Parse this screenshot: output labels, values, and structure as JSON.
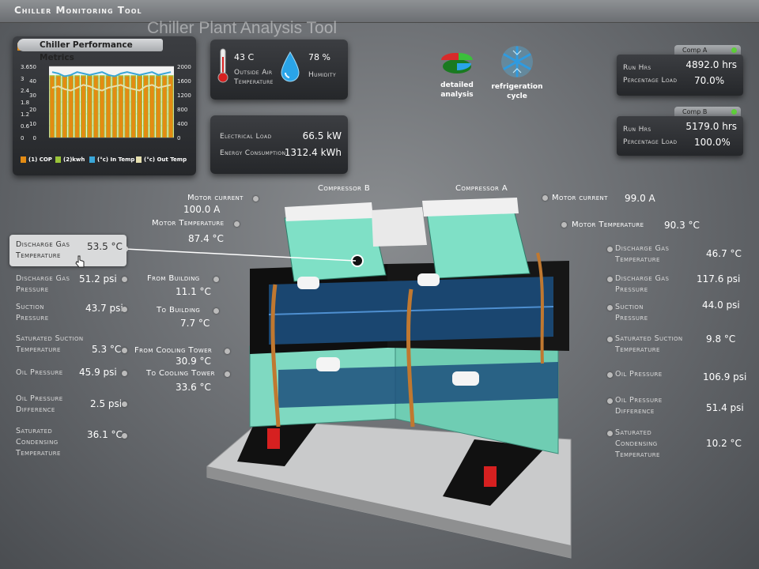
{
  "app_title": "Chiller Monitoring Tool",
  "watermark": "Chiller Plant Analysis Tool",
  "performance": {
    "title": "Chiller Performance Metrics",
    "legend": [
      "(1) COP",
      "(2)kwh",
      "(°c) In Temp",
      "(°c) Out Temp"
    ],
    "colors": {
      "cop": "#e38b14",
      "kwh": "#9ac43a",
      "in_temp": "#3aa6d8",
      "out_temp": "#e6e0b0"
    }
  },
  "chart_data": {
    "type": "bar",
    "left_axis_ticks": [
      "3.6",
      "3",
      "2.4",
      "1.8",
      "1.2",
      "0.6",
      "0"
    ],
    "mid_axis_ticks": [
      "50",
      "40",
      "30",
      "20",
      "10",
      "0"
    ],
    "right_axis_ticks": [
      "2000",
      "1600",
      "1200",
      "800",
      "400",
      "0"
    ],
    "left_ylim": [
      0,
      3.6
    ],
    "right_ylim": [
      0,
      2000
    ],
    "series": [
      {
        "name": "(1) COP",
        "type": "bar",
        "values": [
          3.1,
          3.1,
          3.1,
          3.1,
          3.1,
          3.1,
          3.1,
          3.1,
          3.1,
          3.1,
          3.1,
          3.1,
          3.1,
          3.1,
          3.1,
          3.1,
          3.1,
          3.1,
          3.1,
          3.1
        ]
      },
      {
        "name": "(2)kwh",
        "type": "bar",
        "values": [
          1750,
          1750,
          1750,
          1750,
          1750,
          1750,
          1750,
          1750,
          1750,
          1750,
          1750,
          1750,
          1750,
          1750,
          1750,
          1750,
          1750,
          1750,
          1750,
          1750
        ]
      },
      {
        "name": "(°c) In Temp",
        "type": "line",
        "values": [
          46,
          45,
          43,
          44,
          46,
          45,
          44,
          45,
          46,
          44,
          43,
          45,
          46,
          45,
          44,
          45,
          46,
          44,
          45,
          46
        ]
      },
      {
        "name": "(°c) Out Temp",
        "type": "line",
        "values": [
          35,
          36,
          34,
          33,
          35,
          37,
          36,
          34,
          33,
          35,
          36,
          37,
          35,
          34,
          33,
          36,
          37,
          35,
          36,
          37
        ]
      }
    ]
  },
  "weather": {
    "temp_value": "43 C",
    "temp_label": "Outside Air Temperature",
    "humidity_value": "78 %",
    "humidity_label": "Humidity"
  },
  "energy": {
    "elec_label": "Electrical Load",
    "elec_value": "66.5 kW",
    "cons_label": "Energy Consumption",
    "cons_value": "1312.4 kWh"
  },
  "buttons": {
    "detailed": "detailed analysis",
    "refrigeration": "refrigeration cycle"
  },
  "comp_a_panel": {
    "tab": "Comp A",
    "run_label": "Run Hrs",
    "run_value": "4892.0 hrs",
    "load_label": "Percentage Load",
    "load_value": "70.0%"
  },
  "comp_b_panel": {
    "tab": "Comp B",
    "run_label": "Run Hrs",
    "run_value": "5179.0 hrs",
    "load_label": "Percentage Load",
    "load_value": "100.0%"
  },
  "compressor_b_label": "Compressor B",
  "compressor_a_label": "Compressor A",
  "comp_b_motor": {
    "current_label": "Motor current",
    "current_value": "100.0 A",
    "temp_label": "Motor Temperature",
    "temp_value": "87.4 °C"
  },
  "comp_a_motor": {
    "current_label": "Motor current",
    "current_value": "99.0 A",
    "temp_label": "Motor Temperature",
    "temp_value": "90.3 °C"
  },
  "left_metrics": [
    {
      "label": "Discharge Gas Temperature",
      "value": "53.5 °C"
    },
    {
      "label": "Discharge Gas Pressure",
      "value": "51.2 psi"
    },
    {
      "label": "Suction Pressure",
      "value": "43.7 psi"
    },
    {
      "label": "Saturated Suction Temperature",
      "value": "5.3 °C"
    },
    {
      "label": "Oil Pressure",
      "value": "45.9 psi"
    },
    {
      "label": "Oil Pressure Difference",
      "value": "2.5 psi"
    },
    {
      "label": "Saturated Condensing Temperature",
      "value": "36.1 °C"
    }
  ],
  "right_metrics": [
    {
      "label": "Discharge Gas Temperature",
      "value": "46.7 °C"
    },
    {
      "label": "Discharge Gas Pressure",
      "value": "117.6 psi"
    },
    {
      "label": "Suction Pressure",
      "value": "44.0 psi"
    },
    {
      "label": "Saturated Suction Temperature",
      "value": "9.8 °C"
    },
    {
      "label": "Oil Pressure",
      "value": "106.9 psi"
    },
    {
      "label": "Oil Pressure Difference",
      "value": "51.4 psi"
    },
    {
      "label": "Saturated Condensing Temperature",
      "value": "10.2 °C"
    }
  ],
  "water": [
    {
      "label": "From Building",
      "value": "11.1 °C"
    },
    {
      "label": "To Building",
      "value": "7.7 °C"
    },
    {
      "label": "From Cooling Tower",
      "value": "30.9 °C"
    },
    {
      "label": "To Cooling Tower",
      "value": "33.6 °C"
    }
  ]
}
